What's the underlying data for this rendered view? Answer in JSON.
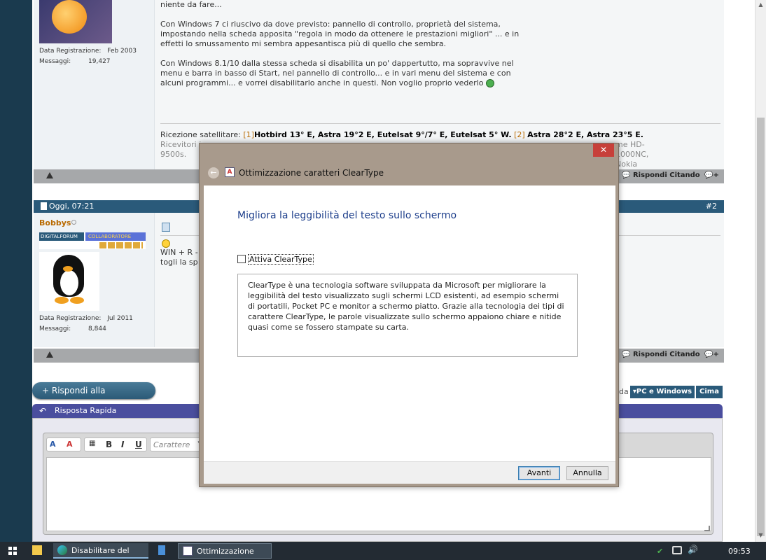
{
  "post1": {
    "user_meta": {
      "reg_label": "Data Registrazione:",
      "reg_value": "Feb 2003",
      "msg_label": "Messaggi:",
      "msg_value": "19,427"
    },
    "lines": [
      "niente da fare...",
      "",
      "Con Windows 7 ci riuscivo da dove previsto: pannello di controllo, proprietà del sistema,",
      "impostando nella scheda apposita \"regola in modo da ottenere le prestazioni migliori\" ... e in",
      "effetti lo smussamento mi sembra appesantisca più di quello che sembra.",
      "",
      "Con Windows 8.1/10 dalla stessa scheda si disabilita un po' dappertutto, ma sopravvive nel",
      "menu e barra in basso di Start, nel pannello di controllo... e in vari menu del sistema e con",
      "alcuni programmi... e vorrei disabilitarlo anche in questi. Non voglio proprio vederlo"
    ],
    "sig_label": "Ricezione satellitare:",
    "sig_n1": "[1]",
    "sig_s1": "Hotbird 13° E, Astra 19°2 E, Eutelsat 9°/7° E, Eutelsat 5° W.",
    "sig_n2": "[2]",
    "sig_s2": "Astra 28°2 E, Astra 23°5 E.",
    "sig_line2_start": "Ricevitori in",
    "sig_line2_end": "me HD-1000NC, Nokia",
    "sig_line3": "9500s.",
    "reply_quote": "Rispondi Citando"
  },
  "post2": {
    "header_date": "Oggi, 07:21",
    "header_num": "#2",
    "username": "Bobbys",
    "badge_left": "DIGITALFORUM",
    "badge_right": "COLLABORATORE",
    "user_meta": {
      "reg_label": "Data Registrazione:",
      "reg_value": "Jul 2011",
      "msg_label": "Messaggi:",
      "msg_value": "8,844"
    },
    "line1": "WIN + R -",
    "line2": "togli la sp",
    "reply_quote": "Rispondi Citando"
  },
  "reply_button": "+ Rispondi alla Discussione",
  "nav": {
    "crumb_tail": "da",
    "section": "PC e Windows",
    "top": "Cima"
  },
  "quick_reply": {
    "title": "Risposta Rapida",
    "font_placeholder": "Carattere"
  },
  "dialog": {
    "title": "Ottimizzazione caratteri ClearType",
    "heading": "Migliora la leggibilità del testo sullo schermo",
    "checkbox_label": "Attiva ClearType",
    "checkbox_checked": false,
    "description": "ClearType è una tecnologia software sviluppata da Microsoft per migliorare la leggibilità del testo visualizzato sugli schermi LCD esistenti, ad esempio schermi di portatili, Pocket PC e monitor a schermo piatto. Grazie alla tecnologia dei tipi di carattere ClearType, le parole visualizzate sullo schermo appaiono chiare e nitide quasi come se fossero stampate su carta.",
    "next_button": "Avanti",
    "cancel_button": "Annulla",
    "close_glyph": "✕"
  },
  "taskbar": {
    "task1": "Disabilitare del tutto ...",
    "task2": "Ottimizzazione caratt...",
    "clock": "09:53"
  }
}
